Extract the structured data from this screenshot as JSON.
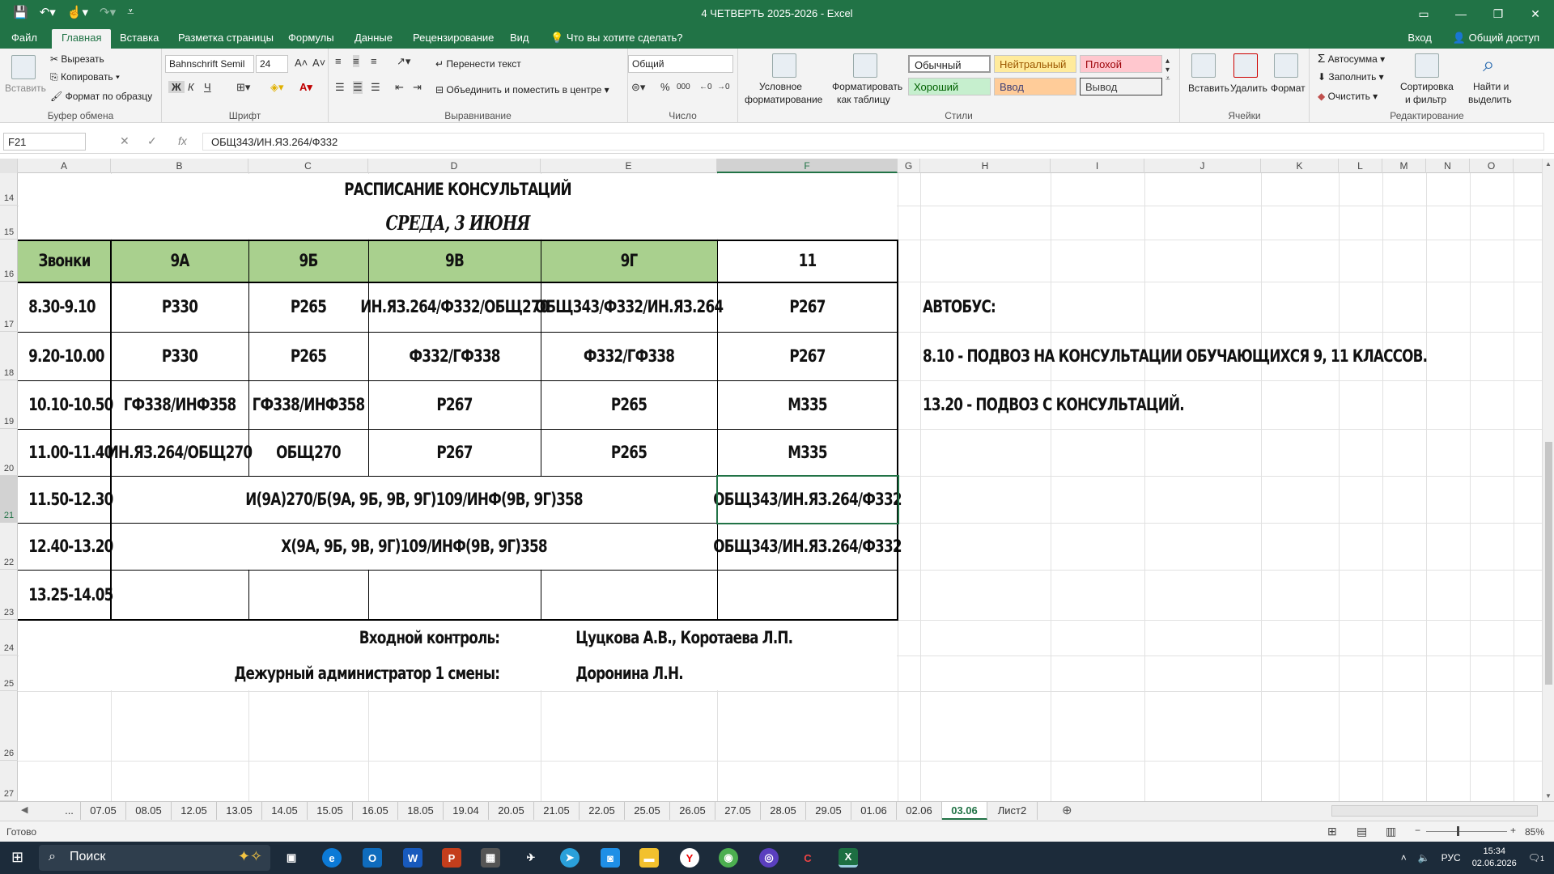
{
  "window": {
    "title": "4 ЧЕТВЕРТЬ 2025-2026  -  Excel"
  },
  "ribbon_tabs": [
    "Файл",
    "Главная",
    "Вставка",
    "Разметка страницы",
    "Формулы",
    "Данные",
    "Рецензирование",
    "Вид"
  ],
  "active_tab": "Главная",
  "tell_me": "Что вы хотите сделать?",
  "signin": "Вход",
  "share": "Общий доступ",
  "ribbon": {
    "clipboard": {
      "paste": "Вставить",
      "cut": "Вырезать",
      "copy": "Копировать",
      "format_painter": "Формат по образцу",
      "label": "Буфер обмена"
    },
    "font": {
      "name": "Bahnschrift Semil",
      "size": "24",
      "bold": "Ж",
      "italic": "К",
      "underline": "Ч",
      "label": "Шрифт"
    },
    "alignment": {
      "wrap": "Перенести текст",
      "merge": "Объединить и поместить в центре",
      "label": "Выравнивание"
    },
    "number": {
      "format": "Общий",
      "label": "Число"
    },
    "styles": {
      "conditional_1": "Условное",
      "conditional_2": "форматирование",
      "as_table_1": "Форматировать",
      "as_table_2": "как таблицу",
      "normal": "Обычный",
      "neutral": "Нейтральный",
      "bad": "Плохой",
      "good": "Хороший",
      "input": "Ввод",
      "output": "Вывод",
      "label": "Стили"
    },
    "cells": {
      "insert": "Вставить",
      "delete": "Удалить",
      "format": "Формат",
      "label": "Ячейки"
    },
    "editing": {
      "autosum": "Автосумма",
      "fill": "Заполнить",
      "clear": "Очистить",
      "sort_1": "Сортировка",
      "sort_2": "и фильтр",
      "find_1": "Найти и",
      "find_2": "выделить",
      "label": "Редактирование"
    }
  },
  "formula_bar": {
    "name_box": "F21",
    "formula": "ОБЩ343/ИН.ЯЗ.264/Ф332"
  },
  "columns": [
    "A",
    "B",
    "C",
    "D",
    "E",
    "F",
    "G",
    "H",
    "I",
    "J",
    "K",
    "L",
    "M",
    "N",
    "O"
  ],
  "selected_column": "F",
  "rows": [
    "14",
    "15",
    "16",
    "17",
    "18",
    "19",
    "20",
    "21",
    "22",
    "23",
    "24",
    "25",
    "26",
    "27"
  ],
  "selected_row": "21",
  "schedule": {
    "title": "РАСПИСАНИЕ КОНСУЛЬТАЦИЙ",
    "subtitle": "СРЕДА, 3 ИЮНЯ",
    "headers": [
      "Звонки",
      "9А",
      "9Б",
      "9В",
      "9Г",
      "11"
    ],
    "rows": [
      [
        "8.30-9.10",
        "Р330",
        "Р265",
        "ИН.ЯЗ.264/Ф332/ОБЩ270",
        "ОБЩ343/Ф332/ИН.ЯЗ.264",
        "Р267"
      ],
      [
        "9.20-10.00",
        "Р330",
        "Р265",
        "Ф332/ГФ338",
        "Ф332/ГФ338",
        "Р267"
      ],
      [
        "10.10-10.50",
        "ГФ338/ИНФ358",
        "ГФ338/ИНФ358",
        "Р267",
        "Р265",
        "М335"
      ],
      [
        "11.00-11.40",
        "ИН.ЯЗ.264/ОБЩ270",
        "ОБЩ270",
        "Р267",
        "Р265",
        "М335"
      ]
    ],
    "merged_rows": [
      {
        "time": "11.50-12.30",
        "merged": "И(9А)270/Б(9А, 9Б, 9В, 9Г)109/ИНФ(9В, 9Г)358",
        "last": "ОБЩ343/ИН.ЯЗ.264/Ф332"
      },
      {
        "time": "12.40-13.20",
        "merged": "Х(9А, 9Б, 9В, 9Г)109/ИНФ(9В, 9Г)358",
        "last": "ОБЩ343/ИН.ЯЗ.264/Ф332"
      }
    ],
    "empty_row_time": "13.25-14.05",
    "control_label": "Входной контроль:",
    "control_value": "Цуцкова А.В., Коротаева Л.П.",
    "admin_label": "Дежурный администратор 1 смены:",
    "admin_value": "Доронина Л.Н."
  },
  "bus": {
    "title": "АВТОБУС:",
    "line1": "8.10 - ПОДВОЗ НА КОНСУЛЬТАЦИИ ОБУЧАЮЩИХСЯ 9, 11 КЛАССОВ.",
    "line2": "13.20 - ПОДВОЗ С КОНСУЛЬТАЦИЙ."
  },
  "sheet_tabs": [
    "...",
    "07.05",
    "08.05",
    "12.05",
    "13.05",
    "14.05",
    "15.05",
    "16.05",
    "18.05",
    "19.04",
    "20.05",
    "21.05",
    "22.05",
    "25.05",
    "26.05",
    "27.05",
    "28.05",
    "29.05",
    "01.06",
    "02.06",
    "03.06",
    "Лист2"
  ],
  "active_sheet": "03.06",
  "status": {
    "ready": "Готово",
    "zoom": "85%"
  },
  "taskbar": {
    "search": "Поиск",
    "lang": "РУС",
    "time": "15:34",
    "date": "02.06.2026",
    "notif": "1"
  },
  "colors": {
    "excel_green": "#217346",
    "header_fill": "#a9d08e"
  }
}
